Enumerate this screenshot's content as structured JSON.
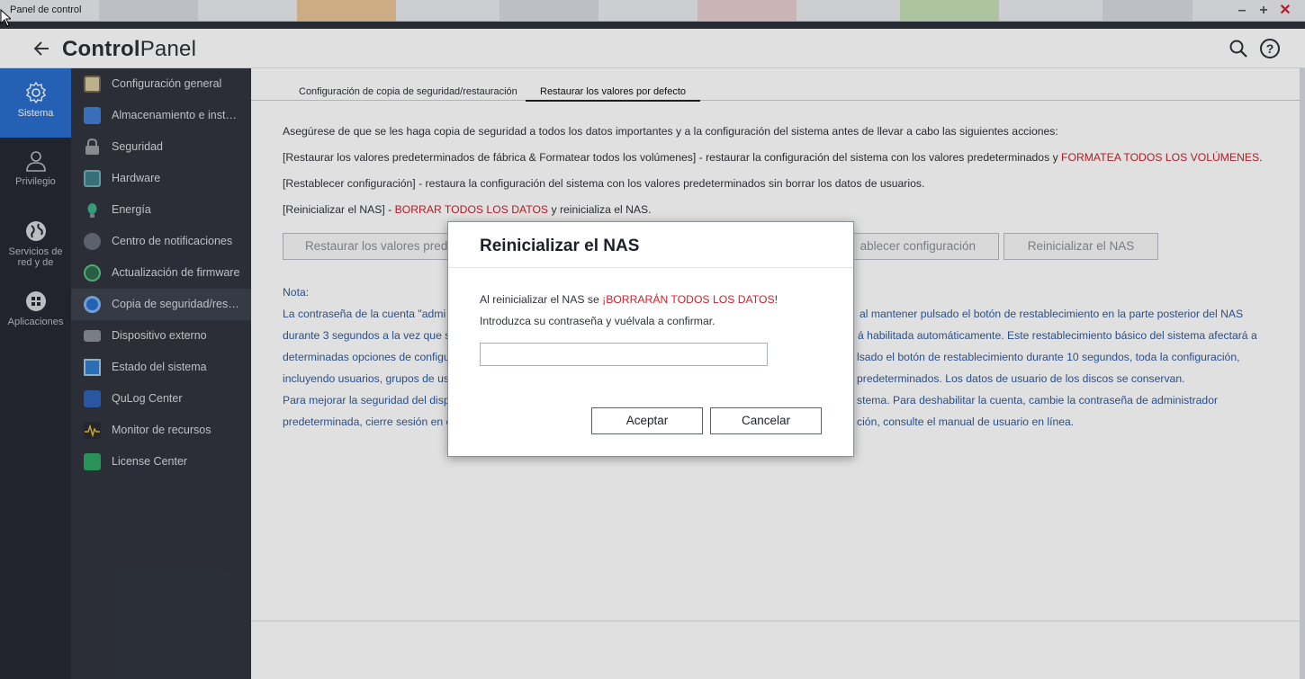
{
  "window": {
    "title": "Panel de control",
    "minimize": "–",
    "maximize": "+",
    "close": "✕"
  },
  "header": {
    "title_bold": "Control",
    "title_light": "Panel"
  },
  "rail": {
    "items": [
      {
        "label": "Sistema",
        "icon": "gear-icon"
      },
      {
        "label": "Privilegio",
        "icon": "user-icon"
      },
      {
        "label": "Servicios de red y de",
        "icon": "globe-icon"
      },
      {
        "label": "Aplicaciones",
        "icon": "apps-grid-icon"
      }
    ]
  },
  "menu": {
    "items": [
      {
        "label": "Configuración general",
        "color": "#c0a060"
      },
      {
        "label": "Almacenamiento e insta…",
        "color": "#3f7fd6"
      },
      {
        "label": "Seguridad",
        "color": "#9aa0a8"
      },
      {
        "label": "Hardware",
        "color": "#4a8f9e"
      },
      {
        "label": "Energía",
        "color": "#3fb08a"
      },
      {
        "label": "Centro de notificaciones",
        "color": "#8a7a6a"
      },
      {
        "label": "Actualización de firmware",
        "color": "#3c9a6a"
      },
      {
        "label": "Copia de seguridad/rest…",
        "color": "#2a6fcf"
      },
      {
        "label": "Dispositivo externo",
        "color": "#8a8f98"
      },
      {
        "label": "Estado del sistema",
        "color": "#2e7fd0"
      },
      {
        "label": "QuLog Center",
        "color": "#2e62b8"
      },
      {
        "label": "Monitor de recursos",
        "color": "#3a3a3a"
      },
      {
        "label": "License Center",
        "color": "#2fa863"
      }
    ]
  },
  "tabs": {
    "backup": "Configuración de copia de seguridad/restauración",
    "restore": "Restaurar los valores por defecto"
  },
  "content": {
    "intro": "Asegúrese de que se les haga copia de seguridad a todos los datos importantes y a la configuración del sistema antes de llevar a cabo las siguientes acciones:",
    "line1_a": "[Restaurar los valores predeterminados de fábrica & Formatear todos los volúmenes] - restaurar la configuración del sistema con los valores predeterminados y ",
    "line1_red": "FORMATEA TODOS LOS VOLÚMENES",
    "line1_b": ".",
    "line2": "[Restablecer configuración] - restaura la configuración del sistema con los valores predeterminados sin borrar los datos de usuarios.",
    "line3_a": "[Reinicializar el NAS] - ",
    "line3_red": "BORRAR TODOS LOS DATOS",
    "line3_b": " y reinicializa el NAS.",
    "buttons": {
      "restore_factory": "Restaurar los valores pred",
      "reset_config": "ablecer configuración",
      "reinit": "Reinicializar el NAS"
    },
    "note_title": "Nota:",
    "note_lines_left": [
      "La contraseña de la cuenta \"admi",
      "durante 3 segundos a la vez que s",
      "determinadas opciones de configu",
      "incluyendo usuarios, grupos de us",
      "Para mejorar la seguridad del disp",
      "predeterminada, cierre sesión en e"
    ],
    "note_lines_right": [
      "al mantener pulsado el botón de restablecimiento en la parte posterior del NAS",
      "á habilitada automáticamente. Este restablecimiento básico del sistema afectará a",
      "lsado el botón de restablecimiento durante 10 segundos, toda la configuración,",
      "predeterminados. Los datos de usuario de los discos se conservan.",
      "stema. Para deshabilitar la cuenta, cambie la contraseña de administrador",
      "ción, consulte el manual de usuario en línea."
    ]
  },
  "dialog": {
    "title": "Reinicializar el NAS",
    "msg_a": "Al reinicializar el NAS se ",
    "msg_red": "¡BORRARÁN TODOS LOS DATOS",
    "msg_b": "! Introduzca su contraseña y vuélvala a confirmar.",
    "password_value": "",
    "ok": "Aceptar",
    "cancel": "Cancelar"
  }
}
